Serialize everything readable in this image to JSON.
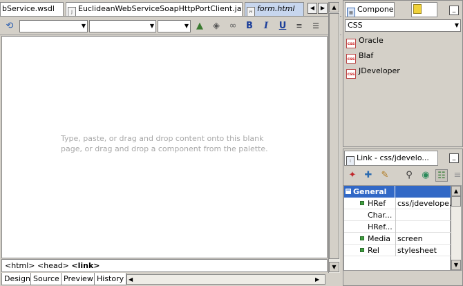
{
  "editor_tabs": [
    {
      "label": "bService.wsdl"
    },
    {
      "label": "EuclideanWebServiceSoapHttpPortClient.java"
    },
    {
      "label": "form.html"
    }
  ],
  "editor": {
    "placeholder_line1": "Type, paste, or drag and drop content onto this blank",
    "placeholder_line2": "page, or drag and drop a component from the palette."
  },
  "status": {
    "crumb1": "<html>",
    "crumb2": "<head>",
    "crumb3": "<link>"
  },
  "bottom_tabs": [
    {
      "label": "Design"
    },
    {
      "label": "Source"
    },
    {
      "label": "Preview"
    },
    {
      "label": "History"
    }
  ],
  "component_palette": {
    "tab_label": "Compone...",
    "category": "CSS",
    "items": [
      {
        "label": "Oracle"
      },
      {
        "label": "Blaf"
      },
      {
        "label": "JDeveloper"
      }
    ]
  },
  "property_inspector": {
    "tab_label": "Link - css/jdevelo...",
    "section": "General",
    "rows": [
      {
        "name": "HRef",
        "value": "css/jdevelope...",
        "bullet": true
      },
      {
        "name": "Char...",
        "value": "",
        "bullet": false
      },
      {
        "name": "HRef...",
        "value": "",
        "bullet": false
      },
      {
        "name": "Media",
        "value": "screen",
        "bullet": true
      },
      {
        "name": "Rel",
        "value": "stylesheet",
        "bullet": true
      }
    ]
  },
  "colors": {
    "selection_blue": "#3168c6",
    "active_tab": "#c7d6ee",
    "placeholder": "#a8a8a8"
  }
}
